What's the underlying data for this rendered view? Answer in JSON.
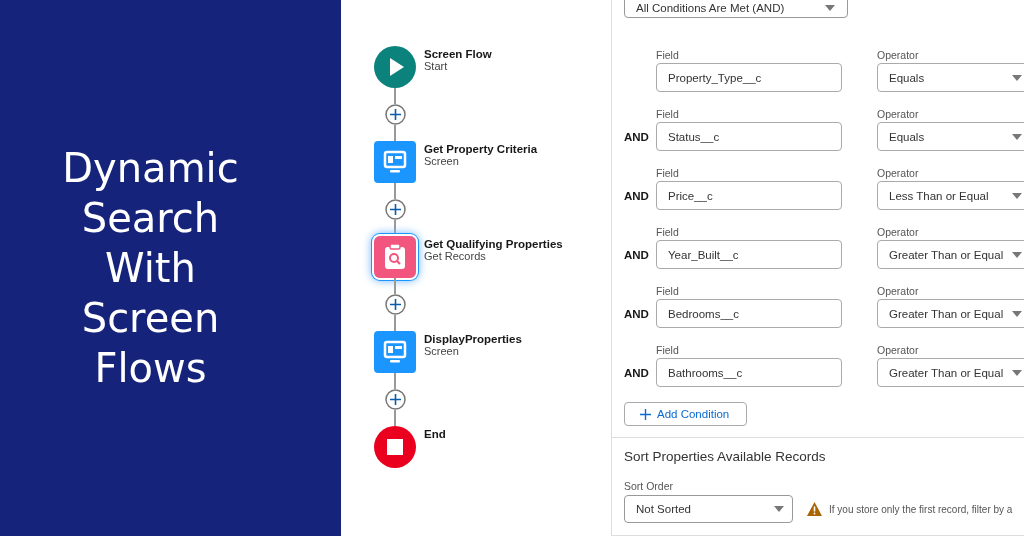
{
  "banner": {
    "title": "Dynamic\nSearch\nWith\nScreen\nFlows"
  },
  "flow": {
    "nodes": [
      {
        "kind": "start",
        "name": "Screen Flow",
        "type": "Start",
        "selected": false
      },
      {
        "kind": "screen",
        "name": "Get Property Criteria",
        "type": "Screen",
        "selected": false
      },
      {
        "kind": "records",
        "name": "Get Qualifying Properties",
        "type": "Get Records",
        "selected": true
      },
      {
        "kind": "screen",
        "name": "DisplayProperties",
        "type": "Screen",
        "selected": false
      },
      {
        "kind": "end",
        "name": "End",
        "selected": false
      }
    ]
  },
  "conditions": {
    "requirement": "All Conditions Are Met (AND)",
    "rows": [
      {
        "connector": null,
        "field_label": "Field",
        "field": "Property_Type__c",
        "operator_label": "Operator",
        "operator": "Equals"
      },
      {
        "connector": "AND",
        "field_label": "Field",
        "field": "Status__c",
        "operator_label": "Operator",
        "operator": "Equals"
      },
      {
        "connector": "AND",
        "field_label": "Field",
        "field": "Price__c",
        "operator_label": "Operator",
        "operator": "Less Than or Equal"
      },
      {
        "connector": "AND",
        "field_label": "Field",
        "field": "Year_Built__c",
        "operator_label": "Operator",
        "operator": "Greater Than or Equal"
      },
      {
        "connector": "AND",
        "field_label": "Field",
        "field": "Bedrooms__c",
        "operator_label": "Operator",
        "operator": "Greater Than or Equal"
      },
      {
        "connector": "AND",
        "field_label": "Field",
        "field": "Bathrooms__c",
        "operator_label": "Operator",
        "operator": "Greater Than or Equal"
      }
    ],
    "add_button": "Add Condition"
  },
  "sort": {
    "heading": "Sort Properties Available Records",
    "label": "Sort Order",
    "value": "Not Sorted",
    "warning": "If you store only the first record, filter by a"
  }
}
